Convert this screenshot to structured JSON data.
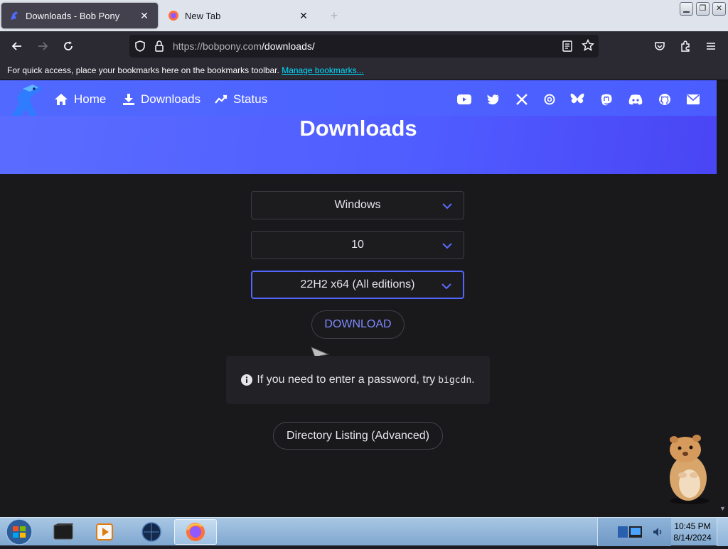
{
  "browser": {
    "tabs": [
      {
        "title": "Downloads - Bob Pony",
        "active": true
      },
      {
        "title": "New Tab",
        "active": false
      }
    ],
    "url_origin": "https://bobpony.com",
    "url_path": "/downloads/",
    "bookmarks_hint": "For quick access, place your bookmarks here on the bookmarks toolbar.",
    "bookmarks_link": "Manage bookmarks..."
  },
  "site_nav": {
    "home": "Home",
    "downloads": "Downloads",
    "status": "Status",
    "social_icons": [
      "youtube-icon",
      "twitter-icon",
      "x-icon",
      "threads-icon",
      "bluesky-icon",
      "mastodon-icon",
      "discord-icon",
      "github-icon",
      "email-icon"
    ]
  },
  "page": {
    "title": "Downloads",
    "os_select": "Windows",
    "version_select": "10",
    "build_select": "22H2 x64 (All editions)",
    "download_button": "DOWNLOAD",
    "info_text": "If you need to enter a password, try",
    "info_code": "bigcdn",
    "info_suffix": ".",
    "directory_button": "Directory Listing (Advanced)"
  },
  "colors": {
    "accent": "#5366ff",
    "hero": "#4f5cff",
    "link": "#00ddff"
  },
  "taskbar": {
    "time": "10:45 PM",
    "date": "8/14/2024"
  }
}
